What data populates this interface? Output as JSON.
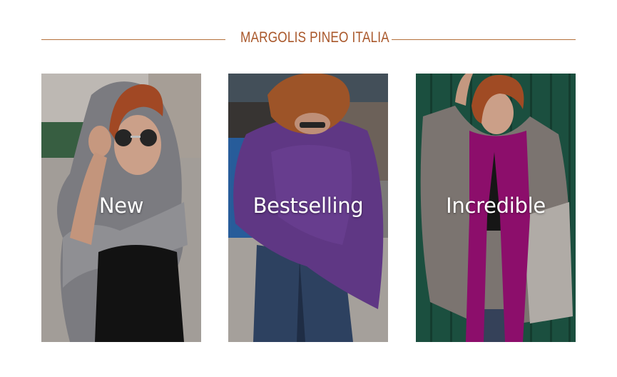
{
  "brand": {
    "title": "MARGOLIS PINEO ITALIA",
    "accent_color": "#a9572a",
    "line_color": "#b4703c"
  },
  "tiles": [
    {
      "label": "New",
      "image_subject": "woman-with-sunglasses-grey-scarf"
    },
    {
      "label": "Bestselling",
      "image_subject": "woman-purple-poncho"
    },
    {
      "label": "Incredible",
      "image_subject": "woman-grey-wrap-magenta-scarf"
    }
  ]
}
